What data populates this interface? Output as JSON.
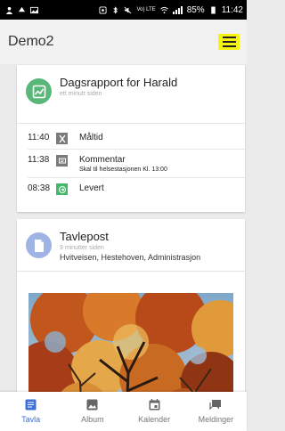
{
  "status_bar": {
    "battery": "85%",
    "time": "11:42",
    "network": "Vo) LTE"
  },
  "app": {
    "title": "Demo2",
    "menu_icon": "hamburger-menu-icon",
    "menu_highlight_color": "#f6f40e"
  },
  "daily_report": {
    "title": "Dagsrapport for Harald",
    "time_ago": "ett minutt siden",
    "avatar_color": "#5ab77a",
    "entries": [
      {
        "time": "11:40",
        "label": "Måltid",
        "sub": "",
        "icon": "meal-icon",
        "color": "#7a7a7a"
      },
      {
        "time": "11:38",
        "label": "Kommentar",
        "sub": "Skal til helsestasjonen Kl. 13:00",
        "icon": "comment-icon",
        "color": "#7a7a7a"
      },
      {
        "time": "08:38",
        "label": "Levert",
        "sub": "",
        "icon": "check-in-icon",
        "color": "#42b86a"
      }
    ]
  },
  "board_post": {
    "title": "Tavlepost",
    "time_ago": "9 minutter siden",
    "tags": "Hvitveisen, Hestehoven, Administrasjon",
    "avatar_color": "#9fb3e4"
  },
  "tabs": [
    {
      "label": "Tavla",
      "icon": "board-icon",
      "active": true
    },
    {
      "label": "Album",
      "icon": "album-icon",
      "active": false
    },
    {
      "label": "Kalender",
      "icon": "calendar-icon",
      "active": false
    },
    {
      "label": "Meldinger",
      "icon": "messages-icon",
      "active": false
    }
  ],
  "accent_color": "#3f6fd8"
}
